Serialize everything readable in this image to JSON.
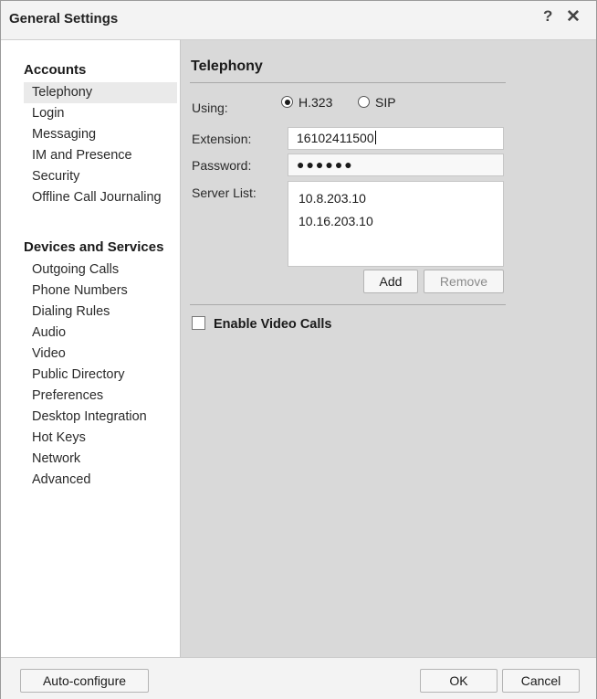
{
  "window": {
    "title": "General Settings",
    "help_glyph": "?",
    "close_glyph": "✕"
  },
  "sidebar": {
    "accounts_heading": "Accounts",
    "accounts_items": [
      "Telephony",
      "Login",
      "Messaging",
      "IM and Presence",
      "Security",
      "Offline Call Journaling"
    ],
    "devices_heading": "Devices and Services",
    "devices_items": [
      "Outgoing Calls",
      "Phone Numbers",
      "Dialing Rules",
      "Audio",
      "Video",
      "Public Directory",
      "Preferences",
      "Desktop Integration",
      "Hot Keys",
      "Network",
      "Advanced"
    ],
    "selected": "Telephony"
  },
  "telephony": {
    "title": "Telephony",
    "using_label": "Using:",
    "protocol_options": [
      "H.323",
      "SIP"
    ],
    "protocol_selected": "H.323",
    "extension_label": "Extension:",
    "extension_value": "16102411500",
    "password_label": "Password:",
    "password_mask": "●●●●●●",
    "server_list_label": "Server List:",
    "servers": [
      "10.8.203.10",
      "10.16.203.10"
    ],
    "add_label": "Add",
    "remove_label": "Remove",
    "enable_video_label": "Enable Video Calls",
    "enable_video_checked": false
  },
  "footer": {
    "auto_configure_label": "Auto-configure",
    "ok_label": "OK",
    "cancel_label": "Cancel"
  }
}
